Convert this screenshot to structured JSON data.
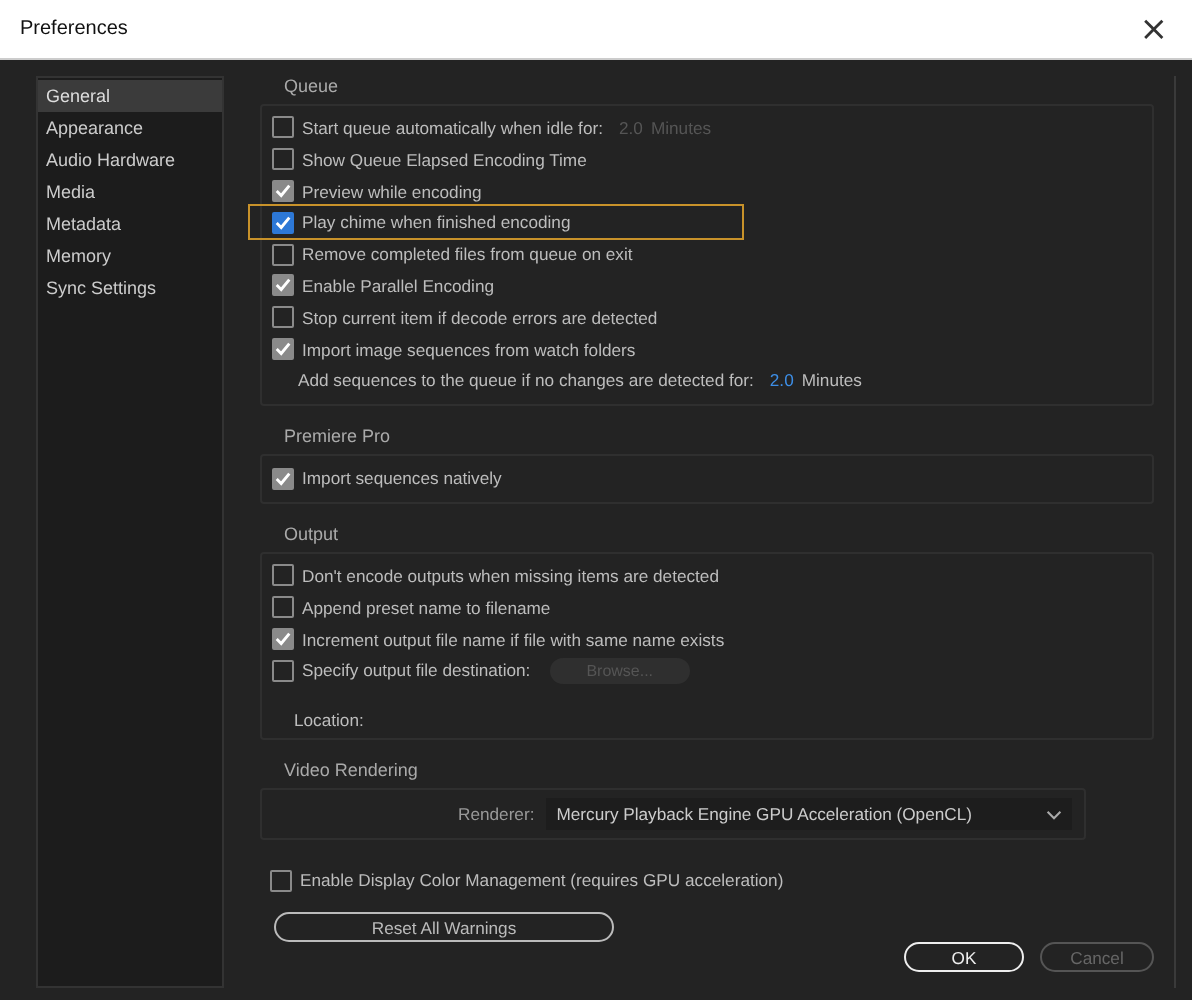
{
  "window": {
    "title": "Preferences",
    "close": "×"
  },
  "sidebar": {
    "items": [
      {
        "label": "General",
        "selected": true
      },
      {
        "label": "Appearance",
        "selected": false
      },
      {
        "label": "Audio Hardware",
        "selected": false
      },
      {
        "label": "Media",
        "selected": false
      },
      {
        "label": "Metadata",
        "selected": false
      },
      {
        "label": "Memory",
        "selected": false
      },
      {
        "label": "Sync Settings",
        "selected": false
      }
    ]
  },
  "queue": {
    "title": "Queue",
    "items": [
      {
        "kind": "checkbox",
        "label": "Start queue automatically when idle for:",
        "checked": false,
        "focused": false,
        "value": "2.0",
        "unit": "Minutes",
        "value_disabled": true
      },
      {
        "kind": "checkbox",
        "label": "Show Queue Elapsed Encoding Time",
        "checked": false,
        "focused": false
      },
      {
        "kind": "checkbox",
        "label": "Preview while encoding",
        "checked": true,
        "focused": false
      },
      {
        "kind": "checkbox",
        "label": "Play chime when finished encoding",
        "checked": true,
        "focused": true
      },
      {
        "kind": "checkbox",
        "label": "Remove completed files from queue on exit",
        "checked": false,
        "focused": false
      },
      {
        "kind": "checkbox",
        "label": "Enable Parallel Encoding",
        "checked": true,
        "focused": false
      },
      {
        "kind": "checkbox",
        "label": "Stop current item if decode errors are detected",
        "checked": false,
        "focused": false
      },
      {
        "kind": "checkbox",
        "label": "Import image sequences from watch folders",
        "checked": true,
        "focused": false
      },
      {
        "kind": "setting",
        "label": "Add sequences to the queue if no changes are detected for:",
        "value": "2.0",
        "unit": "Minutes",
        "value_disabled": false
      }
    ]
  },
  "premiere_pro": {
    "title": "Premiere Pro",
    "items": [
      {
        "kind": "checkbox",
        "label": "Import sequences natively",
        "checked": true,
        "focused": false
      }
    ]
  },
  "output": {
    "title": "Output",
    "items": [
      {
        "kind": "checkbox",
        "label": "Don't encode outputs when missing items are detected",
        "checked": false,
        "focused": false
      },
      {
        "kind": "checkbox",
        "label": "Append preset name to filename",
        "checked": false,
        "focused": false
      },
      {
        "kind": "checkbox",
        "label": "Increment output file name if file with same name exists",
        "checked": true,
        "focused": false
      },
      {
        "kind": "checkbox",
        "label": "Specify output file destination:",
        "checked": false,
        "focused": false,
        "button": "Browse...",
        "button_disabled": true
      }
    ],
    "location_label": "Location:"
  },
  "video_rendering": {
    "title": "Video Rendering",
    "renderer_label": "Renderer:",
    "renderer_value": "Mercury Playback Engine GPU Acceleration (OpenCL)"
  },
  "color_management": {
    "label": "Enable Display Color Management (requires GPU acceleration)",
    "checked": false
  },
  "reset_button": "Reset All Warnings",
  "buttons": [
    {
      "label": "OK",
      "kind": "primary"
    },
    {
      "label": "Cancel",
      "kind": "secondary"
    }
  ]
}
